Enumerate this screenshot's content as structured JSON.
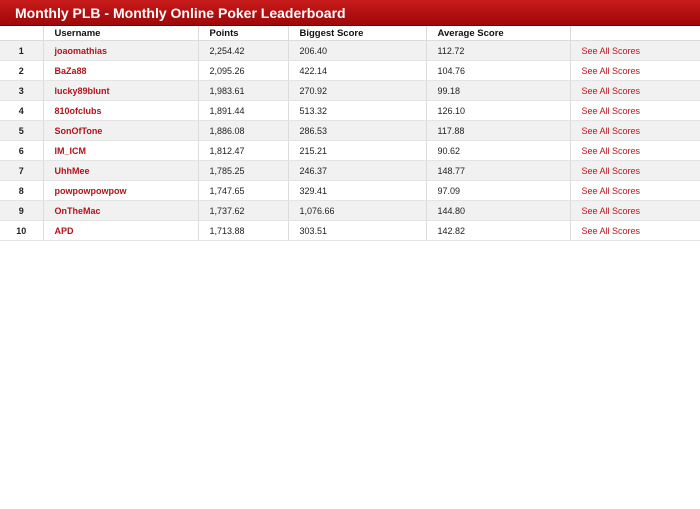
{
  "board": {
    "title": "Monthly PLB - Monthly Online Poker Leaderboard"
  },
  "columns": {
    "rank": "",
    "username": "Username",
    "points": "Points",
    "biggest": "Biggest Score",
    "average": "Average Score",
    "action": ""
  },
  "rows": [
    {
      "rank": "1",
      "username": "joaomathias",
      "points": "2,254.42",
      "biggest": "206.40",
      "average": "112.72",
      "action": "See All Scores"
    },
    {
      "rank": "2",
      "username": "BaZa88",
      "points": "2,095.26",
      "biggest": "422.14",
      "average": "104.76",
      "action": "See All Scores"
    },
    {
      "rank": "3",
      "username": "lucky89blunt",
      "points": "1,983.61",
      "biggest": "270.92",
      "average": "99.18",
      "action": "See All Scores"
    },
    {
      "rank": "4",
      "username": "810ofclubs",
      "points": "1,891.44",
      "biggest": "513.32",
      "average": "126.10",
      "action": "See All Scores"
    },
    {
      "rank": "5",
      "username": "SonOfTone",
      "points": "1,886.08",
      "biggest": "286.53",
      "average": "117.88",
      "action": "See All Scores"
    },
    {
      "rank": "6",
      "username": "IM_ICM",
      "points": "1,812.47",
      "biggest": "215.21",
      "average": "90.62",
      "action": "See All Scores"
    },
    {
      "rank": "7",
      "username": "UhhMee",
      "points": "1,785.25",
      "biggest": "246.37",
      "average": "148.77",
      "action": "See All Scores"
    },
    {
      "rank": "8",
      "username": "powpowpowpow",
      "points": "1,747.65",
      "biggest": "329.41",
      "average": "97.09",
      "action": "See All Scores"
    },
    {
      "rank": "9",
      "username": "OnTheMac",
      "points": "1,737.62",
      "biggest": "1,076.66",
      "average": "144.80",
      "action": "See All Scores"
    },
    {
      "rank": "10",
      "username": "APD",
      "points": "1,713.88",
      "biggest": "303.51",
      "average": "142.82",
      "action": "See All Scores"
    }
  ],
  "colors": {
    "title_bar": "#b10f10",
    "link": "#c0151c",
    "row_alt": "#f1f1f1"
  }
}
